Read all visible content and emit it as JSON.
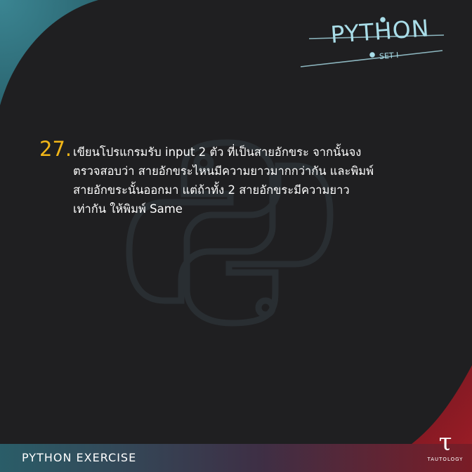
{
  "header": {
    "title": "PYTHON",
    "set_label": "SET I"
  },
  "question": {
    "number": "27.",
    "text": "เขียนโปรแกรมรับ input 2 ตัว ที่เป็นสายอักขระ จากนั้นจง ตรวจสอบว่า สายอักขระไหนมีความยาวมากกว่ากัน และพิมพ์ สายอักขระนั้นออกมา แต่ถ้าทั้ง 2 สายอักขระมีความยาว เท่ากัน ให้พิมพ์ Same",
    "lines": [
      "เขียนโปรแกรมรับ input 2 ตัว ที่เป็นสายอักขระ จากนั้นจง",
      "ตรวจสอบว่า สายอักขระไหนมีความยาวมากกว่ากัน และพิมพ์",
      "สายอักขระนั้นออกมา แต่ถ้าทั้ง 2 สายอักขระมีความยาว",
      "เท่ากัน ให้พิมพ์ Same"
    ]
  },
  "footer": {
    "label": "PYTHON EXERCISE",
    "brand_glyph": "τ",
    "brand_name": "TAUTOLOGY"
  },
  "colors": {
    "background": "#1f1f21",
    "number_accent": "#f2b618",
    "teal_corner": "#2f6f7c",
    "red_corner": "#8b1a22",
    "title": "#a9dde8",
    "text": "#ffffff"
  },
  "icons": [
    "python-logo-watermark-icon",
    "tautology-logo-icon"
  ]
}
